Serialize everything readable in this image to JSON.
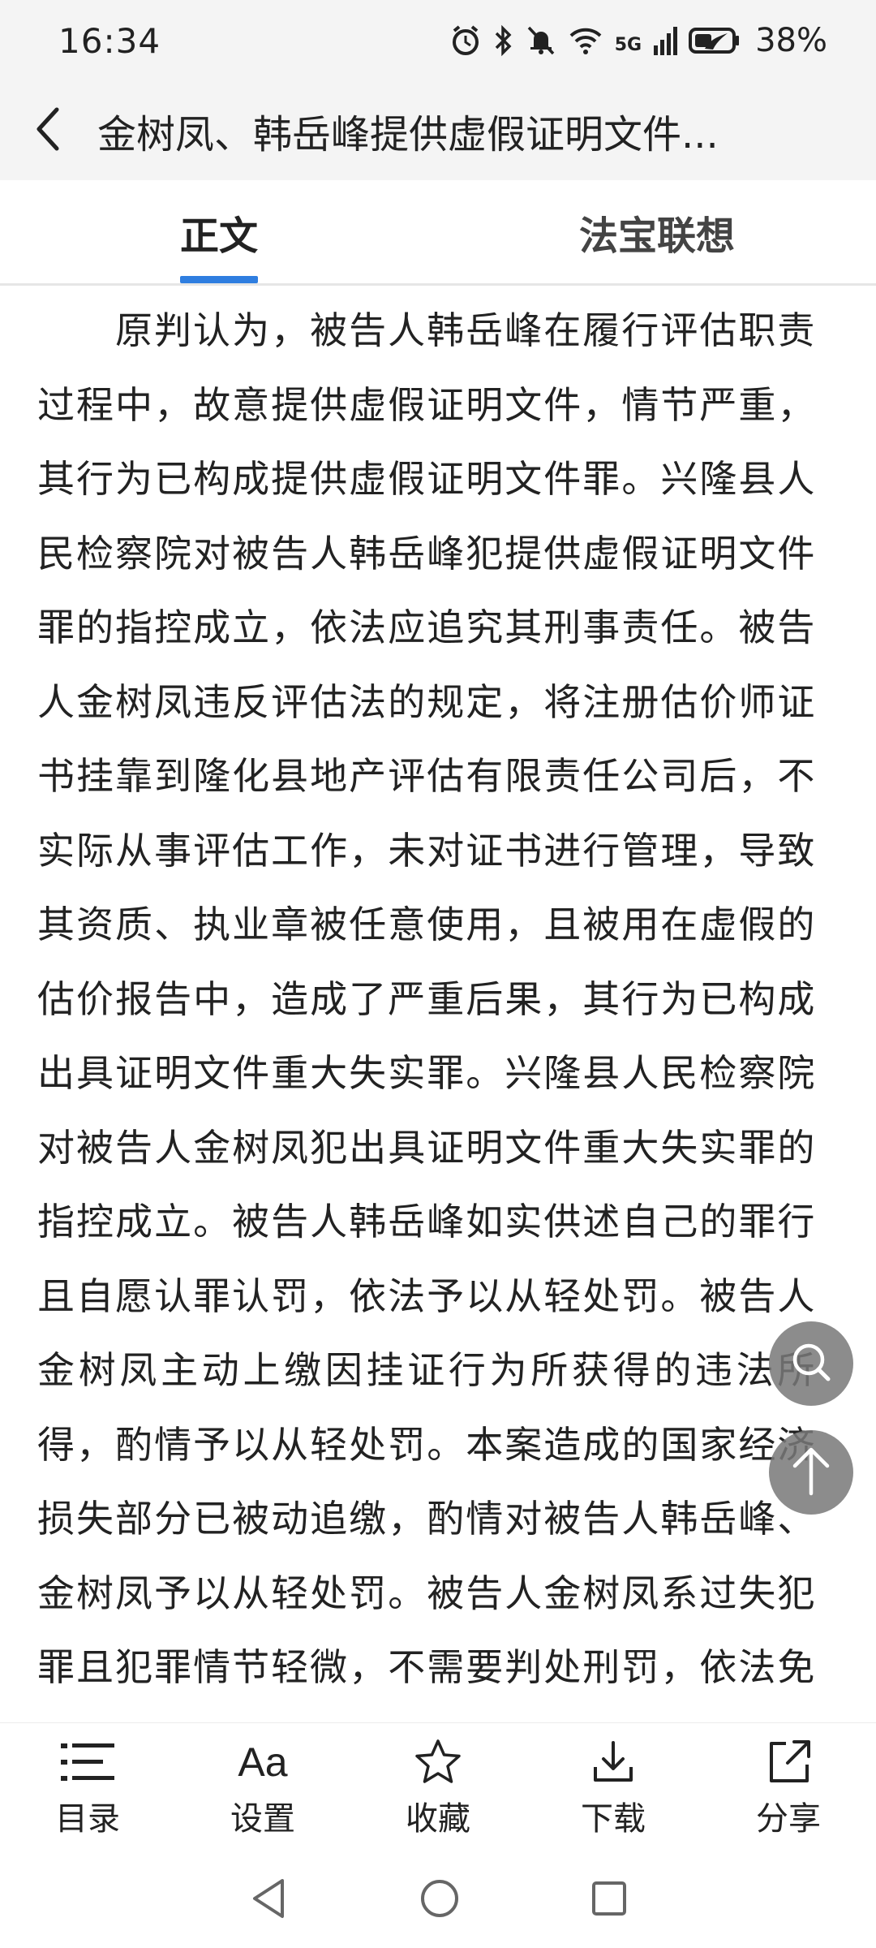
{
  "status": {
    "time": "16:34",
    "network_label": "5G",
    "battery": "38%"
  },
  "header": {
    "title": "金树凤、韩岳峰提供虚假证明文件...",
    "back_icon": "chevron-left-icon"
  },
  "tabs": [
    {
      "label": "正文",
      "active": true
    },
    {
      "label": "法宝联想",
      "active": false
    }
  ],
  "colors": {
    "accent": "#2f7ee0",
    "fab_bg": "#787878"
  },
  "article": {
    "body": "原判认为，被告人韩岳峰在履行评估职责过程中，故意提供虚假证明文件，情节严重，其行为已构成提供虚假证明文件罪。兴隆县人民检察院对被告人韩岳峰犯提供虚假证明文件罪的指控成立，依法应追究其刑事责任。被告人金树凤违反评估法的规定，将注册估价师证书挂靠到隆化县地产评估有限责任公司后，不实际从事评估工作，未对证书进行管理，导致其资质、执业章被任意使用，且被用在虚假的估价报告中，造成了严重后果，其行为已构成出具证明文件重大失实罪。兴隆县人民检察院对被告人金树凤犯出具证明文件重大失实罪的指控成立。被告人韩岳峰如实供述自己的罪行且自愿认罪认罚，依法予以从轻处罚。被告人金树凤主动上缴因挂证行为所获得的违法所得，酌情予以从轻处罚。本案造成的国家经济损失部分已被动追缴，酌情对被告人韩岳峰、金树凤予以从轻处罚。被告人金树凤系过失犯罪且犯罪情节轻微，不需要判处刑罚，依法免予刑事处罚。被告人韩岳峰的辩护人关于对其"
  },
  "floating_buttons": [
    {
      "name": "search",
      "icon": "search-icon"
    },
    {
      "name": "back-to-top",
      "icon": "arrow-up-icon"
    }
  ],
  "toolbar": {
    "items": [
      {
        "label": "目录",
        "icon": "list-icon"
      },
      {
        "label": "设置",
        "icon": "font-size-icon",
        "icon_text": "Aa"
      },
      {
        "label": "收藏",
        "icon": "star-icon"
      },
      {
        "label": "下载",
        "icon": "download-icon"
      },
      {
        "label": "分享",
        "icon": "share-icon"
      }
    ]
  },
  "nav": {
    "items": [
      "back-triangle-icon",
      "home-circle-icon",
      "recents-square-icon"
    ]
  }
}
